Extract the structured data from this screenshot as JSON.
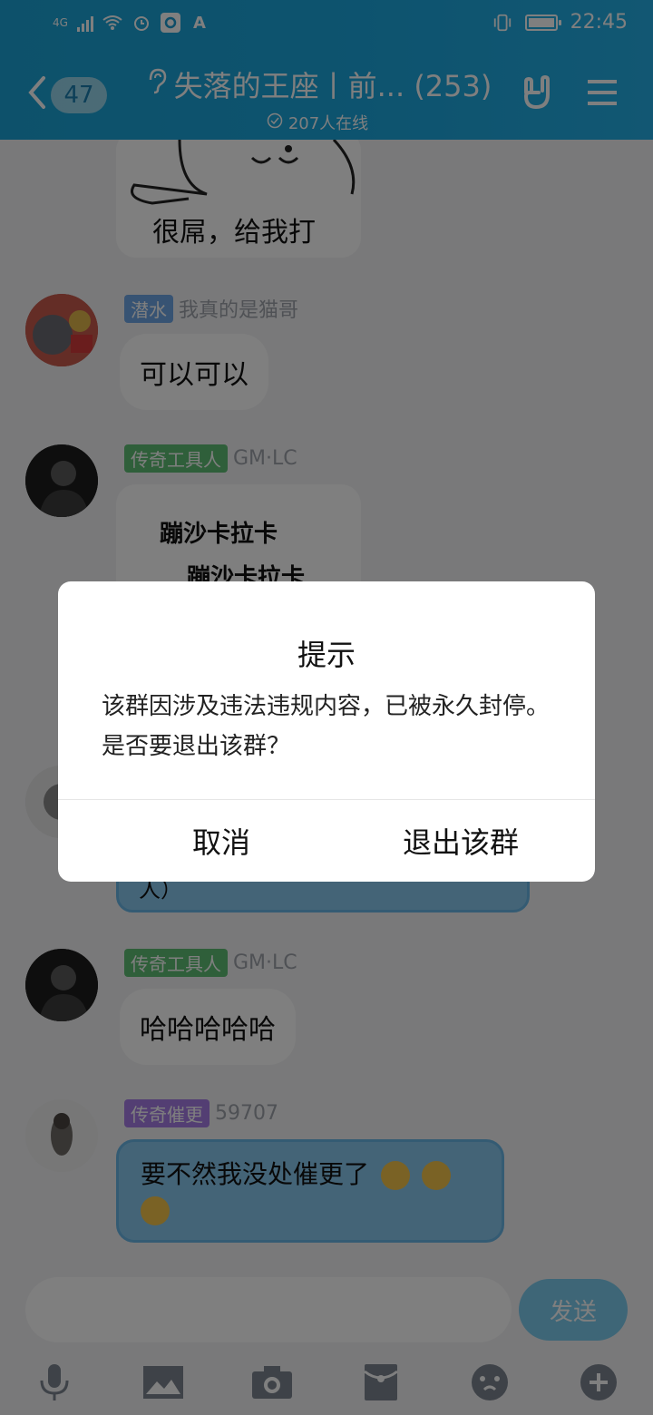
{
  "status_bar": {
    "network": "4G",
    "time": "22:45"
  },
  "navbar": {
    "unread_count": "47",
    "title": "失落的王座丨前... (253)",
    "online": "207人在线"
  },
  "messages": [
    {
      "image_caption": "很屌，给我打"
    },
    {
      "tag": "潜水",
      "tag_color": "#6fa7e6",
      "nick": "我真的是猫哥",
      "text": "可以可以"
    },
    {
      "tag": "传奇工具人",
      "tag_color": "#5fbf74",
      "nick": "GM·LC",
      "sticker_line1": "蹦沙卡拉卡",
      "sticker_line2": "蹦沙卡拉卡"
    },
    {
      "partial_text": "人）"
    },
    {
      "tag": "传奇工具人",
      "tag_color": "#5fbf74",
      "nick": "GM·LC",
      "text": "哈哈哈哈哈"
    },
    {
      "tag": "传奇催更",
      "tag_color": "#a67ce6",
      "nick": "59707",
      "text": "要不然我没处催更了"
    }
  ],
  "input": {
    "placeholder": "",
    "send_label": "发送"
  },
  "toolbar": {
    "icons": [
      "microphone-icon",
      "image-icon",
      "camera-icon",
      "red-packet-icon",
      "emoji-icon",
      "plus-icon"
    ]
  },
  "dialog": {
    "title": "提示",
    "message": "该群因涉及违法违规内容，已被永久封停。是否要退出该群？",
    "cancel_label": "取消",
    "confirm_label": "退出该群"
  }
}
